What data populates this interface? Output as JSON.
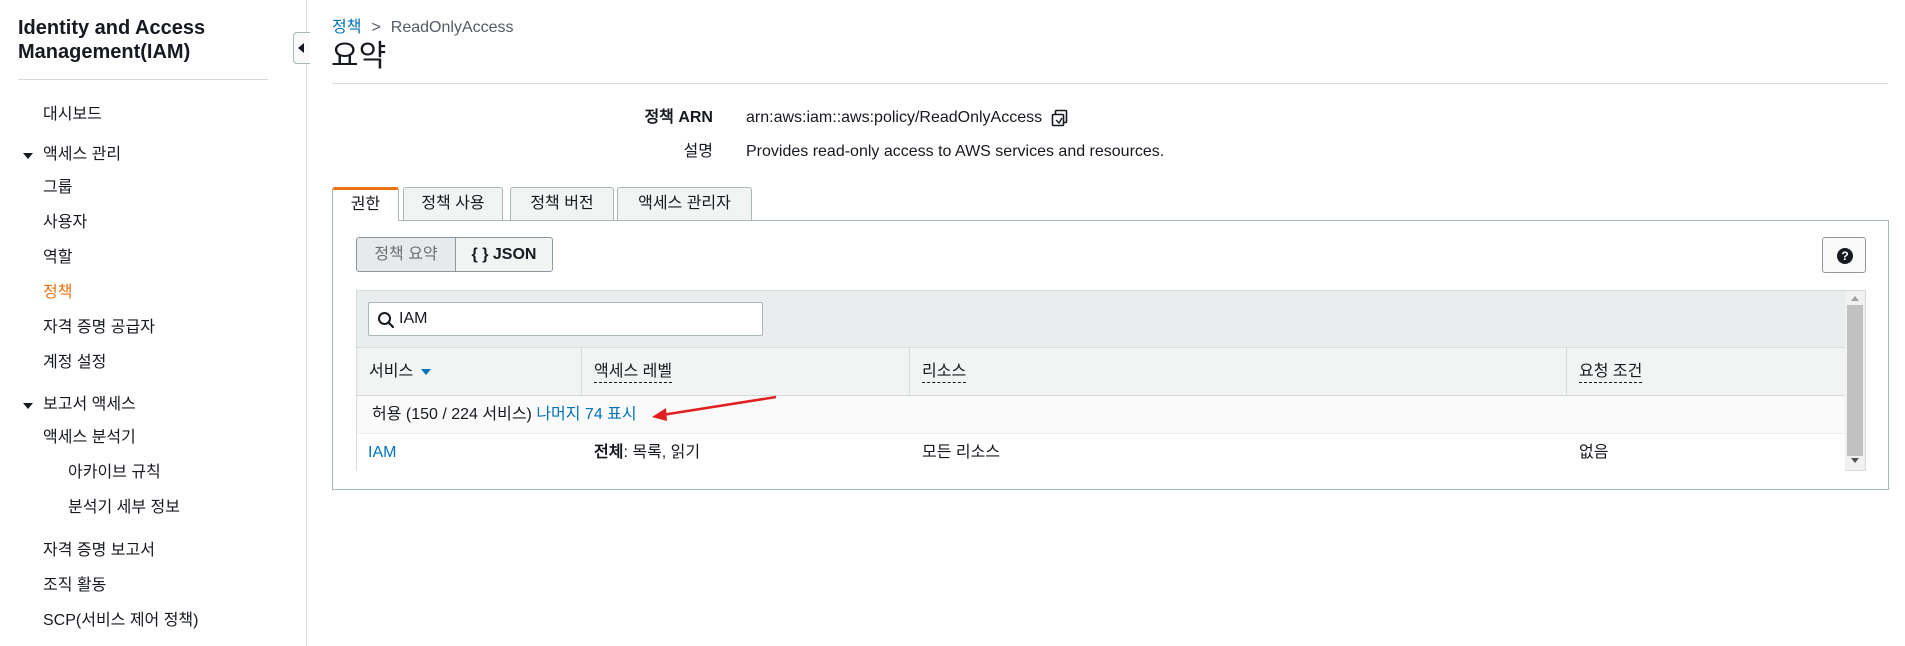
{
  "sidebar": {
    "title": "Identity and Access Management(IAM)",
    "items": {
      "dashboard": "대시보드",
      "access_mgmt": "액세스 관리",
      "groups": "그룹",
      "users": "사용자",
      "roles": "역할",
      "policies": "정책",
      "identity_providers": "자격 증명 공급자",
      "account_settings": "계정 설정",
      "access_reports": "보고서 액세스",
      "access_analyzer": "액세스 분석기",
      "archive_rules": "아카이브 규칙",
      "analyzer_details": "분석기 세부 정보",
      "credential_report": "자격 증명 보고서",
      "org_activity": "조직 활동",
      "scp": "SCP(서비스 제어 정책)"
    }
  },
  "breadcrumb": {
    "parent": "정책",
    "separator": ">",
    "current": "ReadOnlyAccess"
  },
  "page": {
    "title": "요약"
  },
  "summary": {
    "arn_label": "정책 ARN",
    "arn_value": "arn:aws:iam::aws:policy/ReadOnlyAccess",
    "desc_label": "설명",
    "desc_value": "Provides read-only access to AWS services and resources."
  },
  "tabs": {
    "permissions": "권한",
    "policy_usage": "정책 사용",
    "policy_versions": "정책 버전",
    "access_advisor": "액세스 관리자"
  },
  "view_toggle": {
    "summary": "정책 요약",
    "json": "{ } JSON"
  },
  "help": {
    "icon_text": "?"
  },
  "search": {
    "value": "IAM"
  },
  "table": {
    "columns": {
      "service": "서비스",
      "access_level": "액세스 레벨",
      "resource": "리소스",
      "request_condition": "요청 조건"
    },
    "group": {
      "label": "허용 (150 / 224 서비스)",
      "show_more": "나머지 74 표시"
    },
    "rows": [
      {
        "service": "IAM",
        "access_level_bold": "전체",
        "access_level_rest": ": 목록, 읽기",
        "resource": "모든 리소스",
        "request_condition": "없음"
      }
    ]
  },
  "colors": {
    "accent": "#ec7211",
    "link": "#0073bb",
    "annotation_arrow": "#e02020"
  }
}
